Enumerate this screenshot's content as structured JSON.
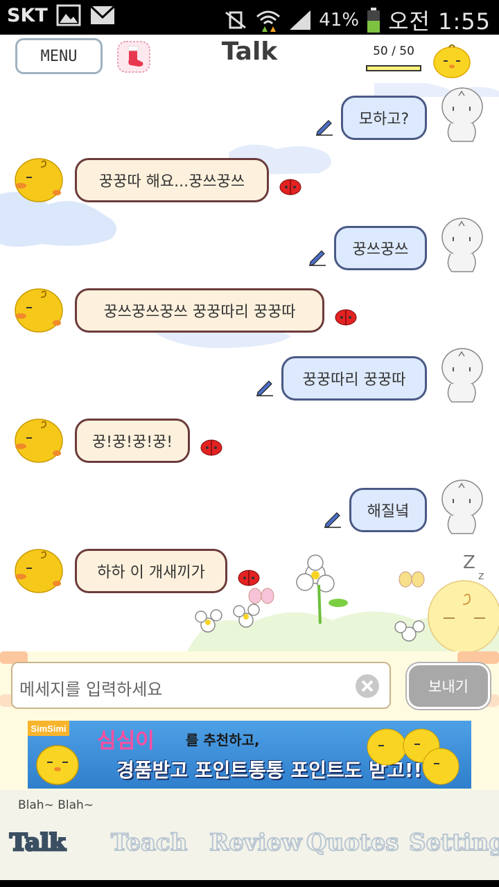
{
  "status_bar": {
    "carrier": "SKT",
    "battery": "41%",
    "time": "오전 1:55"
  },
  "header": {
    "menu_label": "MENU",
    "title": "Talk",
    "counter": "50 / 50",
    "counter_fraction": 1.0
  },
  "messages": [
    {
      "side": "right",
      "text": "모하고?"
    },
    {
      "side": "left",
      "text": "꿍꿍따 해요...꿍쓰꿍쓰"
    },
    {
      "side": "right",
      "text": "꿍쓰꿍쓰"
    },
    {
      "side": "left",
      "text": "꿍쓰꿍쓰꿍쓰 꿍꿍따리 꿍꿍따"
    },
    {
      "side": "right",
      "text": "꿍꿍따리 꿍꿍따"
    },
    {
      "side": "left",
      "text": "꿍!꿍!꿍!꿍!"
    },
    {
      "side": "right",
      "text": "해질녘"
    },
    {
      "side": "left",
      "text": "하하 이 개새끼가"
    }
  ],
  "input": {
    "placeholder": "메세지를 입력하세요",
    "send_label": "보내기"
  },
  "banner": {
    "badge": "SimSimi",
    "line1_name": "심심이",
    "line1_rest": "를 추천하고,",
    "line2": "경품받고 포인트통통 포인트도 받고!!"
  },
  "nav": {
    "blah": "Blah~ Blah~",
    "items": [
      "Talk",
      "Teach",
      "Review",
      "Quotes",
      "Setting"
    ]
  },
  "colors": {
    "left_bubble_bg": "#fdf1dd",
    "left_bubble_border": "#6b3b3b",
    "right_bubble_bg": "#dde9fd",
    "right_bubble_border": "#4a5a85",
    "accent_yellow": "#f6c81a"
  }
}
